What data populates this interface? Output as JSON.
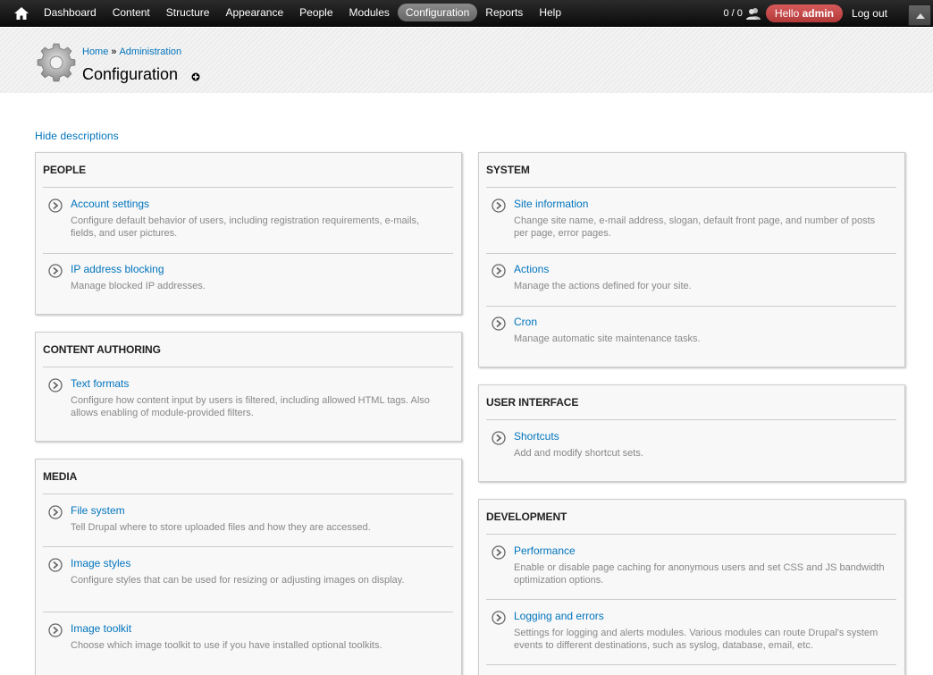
{
  "toolbar": {
    "menu": [
      "Dashboard",
      "Content",
      "Structure",
      "Appearance",
      "People",
      "Modules",
      "Configuration",
      "Reports",
      "Help"
    ],
    "active": "Configuration",
    "user_count": "0 / 0",
    "hello_prefix": "Hello",
    "hello_user": "admin",
    "logout": "Log out"
  },
  "breadcrumb": {
    "home": "Home",
    "separator": "»",
    "admin": "Administration"
  },
  "page_title": "Configuration",
  "hide_descriptions": "Hide descriptions",
  "sections": {
    "people": {
      "title": "PEOPLE",
      "items": [
        {
          "title": "Account settings",
          "desc": "Configure default behavior of users, including registration requirements, e-mails, fields, and user pictures."
        },
        {
          "title": "IP address blocking",
          "desc": "Manage blocked IP addresses."
        }
      ]
    },
    "content_authoring": {
      "title": "CONTENT AUTHORING",
      "items": [
        {
          "title": "Text formats",
          "desc": "Configure how content input by users is filtered, including allowed HTML tags. Also allows enabling of module-provided filters."
        }
      ]
    },
    "media": {
      "title": "MEDIA",
      "items": [
        {
          "title": "File system",
          "desc": "Tell Drupal where to store uploaded files and how they are accessed."
        },
        {
          "title": "Image styles",
          "desc": "Configure styles that can be used for resizing or adjusting images on display."
        },
        {
          "title": "Image toolkit",
          "desc": "Choose which image toolkit to use if you have installed optional toolkits."
        }
      ]
    },
    "system": {
      "title": "SYSTEM",
      "items": [
        {
          "title": "Site information",
          "desc": "Change site name, e-mail address, slogan, default front page, and number of posts per page, error pages."
        },
        {
          "title": "Actions",
          "desc": "Manage the actions defined for your site."
        },
        {
          "title": "Cron",
          "desc": "Manage automatic site maintenance tasks."
        }
      ]
    },
    "user_interface": {
      "title": "USER INTERFACE",
      "items": [
        {
          "title": "Shortcuts",
          "desc": "Add and modify shortcut sets."
        }
      ]
    },
    "development": {
      "title": "DEVELOPMENT",
      "items": [
        {
          "title": "Performance",
          "desc": "Enable or disable page caching for anonymous users and set CSS and JS bandwidth optimization options."
        },
        {
          "title": "Logging and errors",
          "desc": "Settings for logging and alerts modules. Various modules can route Drupal's system events to different destinations, such as syslog, database, email, etc."
        }
      ]
    }
  }
}
